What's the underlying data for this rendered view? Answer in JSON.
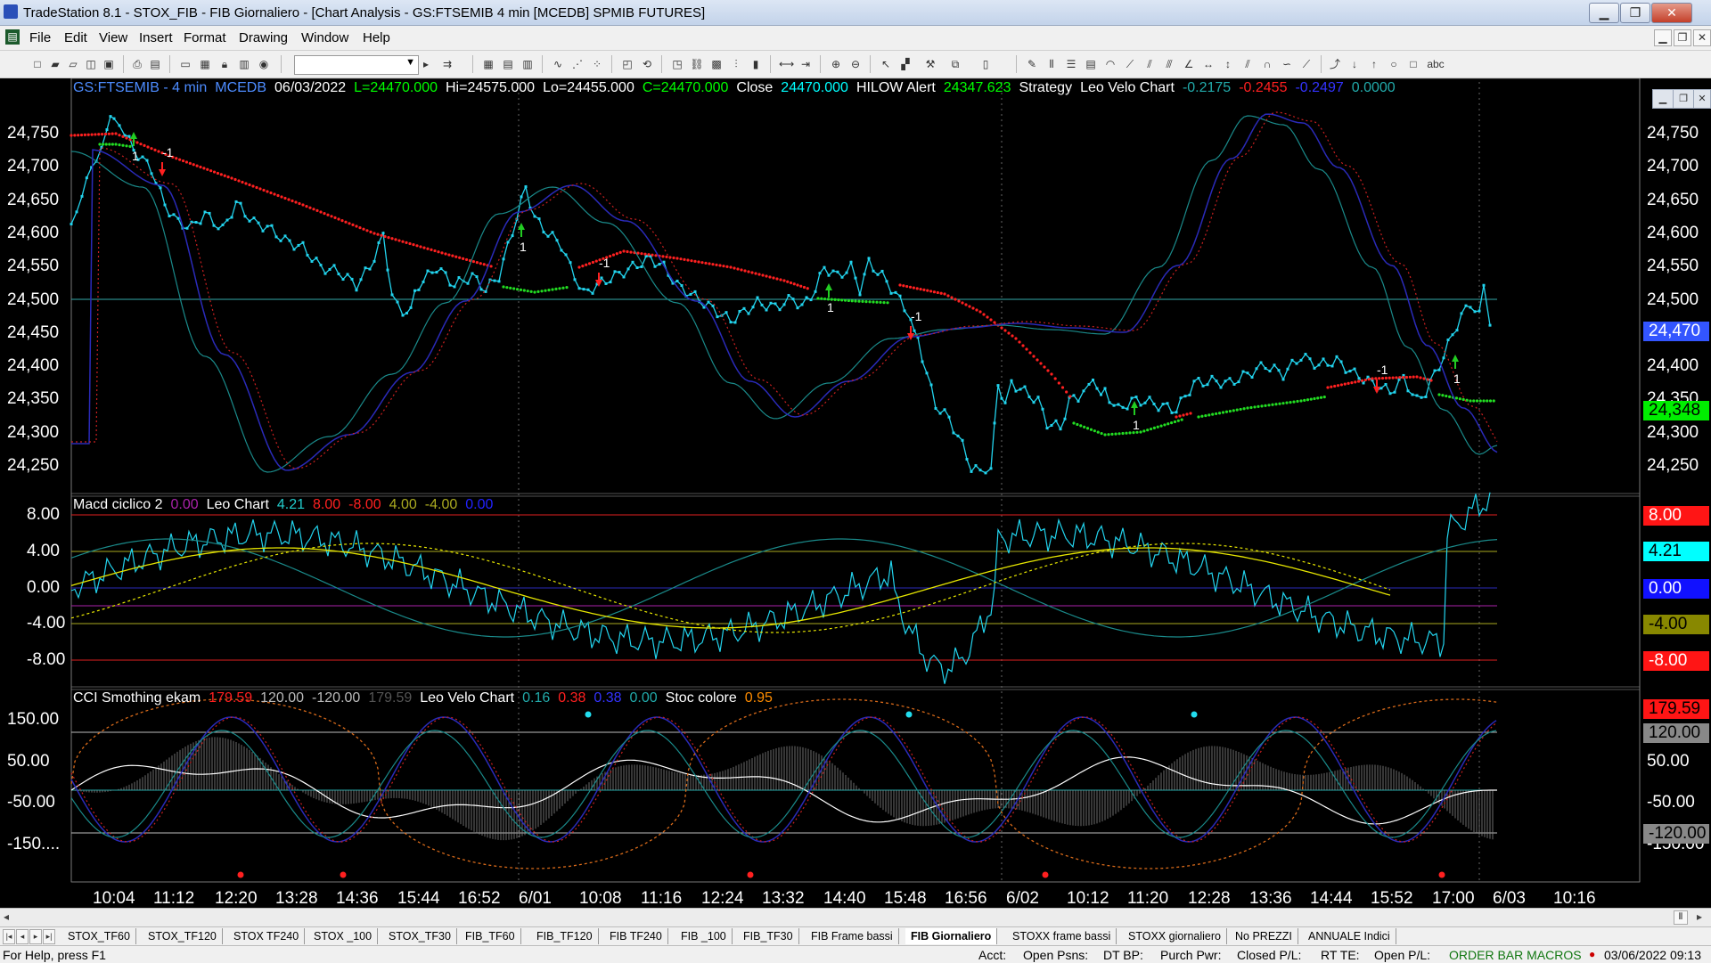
{
  "window": {
    "title": "TradeStation 8.1 - STOX_FIB - FIB Giornaliero - [Chart Analysis - GS:FTSEMIB  4 min  [MCEDB] SPMIB FUTURES]",
    "min_glyph": "▁",
    "max_glyph": "❐",
    "close_glyph": "✕"
  },
  "menu": {
    "items": [
      "File",
      "Edit",
      "View",
      "Insert",
      "Format",
      "Drawing",
      "Window",
      "Help"
    ],
    "mdi_min": "▁",
    "mdi_restore": "❐",
    "mdi_close": "✕"
  },
  "toolbar": {
    "combo_arrow": "▼",
    "icons": [
      "new-icon",
      "open-icon",
      "open-workspace-icon",
      "new-workspace-icon",
      "save-icon",
      "print-icon",
      "print-preview-icon",
      "window-icon",
      "window-tile-icon",
      "lock-icon",
      "macro-icon",
      "globe-icon",
      "play-icon",
      "go-icon",
      "chart-icon",
      "bar-icon",
      "candle-icon",
      "line-icon",
      "dots-icon",
      "scatter-icon",
      "insert-icon",
      "refresh-icon",
      "window-new-icon",
      "link-icon",
      "quote-icon",
      "stats-icon",
      "histo-icon",
      "gauge-icon",
      "speed-icon",
      "zoom-in-icon",
      "zoom-out-icon",
      "cursor-icon",
      "chart-type-icon",
      "tools-icon",
      "format-icon",
      "scroll-icon"
    ]
  },
  "chart": {
    "price_header": [
      {
        "t": "GS:FTSEMIB - 4 min",
        "c": "#4d8cff"
      },
      {
        "t": "MCEDB",
        "c": "#4d8cff"
      },
      {
        "t": "06/03/2022",
        "c": "#ffffff"
      },
      {
        "t": "L=24470.000",
        "c": "#00ff00"
      },
      {
        "t": "Hi=24575.000",
        "c": "#ffffff"
      },
      {
        "t": "Lo=24455.000",
        "c": "#ffffff"
      },
      {
        "t": "C=24470.000",
        "c": "#00ff00"
      },
      {
        "t": "Close",
        "c": "#ffffff"
      },
      {
        "t": "24470.000",
        "c": "#00ffff"
      },
      {
        "t": "HILOW Alert",
        "c": "#ffffff"
      },
      {
        "t": "24347.623",
        "c": "#00ff00"
      },
      {
        "t": "Strategy",
        "c": "#ffffff"
      },
      {
        "t": "Leo Velo Chart",
        "c": "#ffffff"
      },
      {
        "t": "-0.2175",
        "c": "#22aaaa"
      },
      {
        "t": "-0.2455",
        "c": "#ff2020"
      },
      {
        "t": "-0.2497",
        "c": "#3333ff"
      },
      {
        "t": "0.0000",
        "c": "#22aaaa"
      }
    ],
    "macd_header": [
      {
        "t": "Macd ciclico 2",
        "c": "#ffffff"
      },
      {
        "t": "0.00",
        "c": "#aa22aa"
      },
      {
        "t": "Leo Chart",
        "c": "#ffffff"
      },
      {
        "t": "4.21",
        "c": "#22cccc"
      },
      {
        "t": "8.00",
        "c": "#ff2020"
      },
      {
        "t": "-8.00",
        "c": "#ff2020"
      },
      {
        "t": "4.00",
        "c": "#aaaa20"
      },
      {
        "t": "-4.00",
        "c": "#aaaa20"
      },
      {
        "t": "0.00",
        "c": "#2222ff"
      }
    ],
    "cci_header": [
      {
        "t": "CCI Smothing ekam",
        "c": "#ffffff"
      },
      {
        "t": "179.59",
        "c": "#ff2020"
      },
      {
        "t": "120.00",
        "c": "#bbbbbb"
      },
      {
        "t": "-120.00",
        "c": "#bbbbbb"
      },
      {
        "t": "179.59",
        "c": "#555555"
      },
      {
        "t": "Leo Velo Chart",
        "c": "#ffffff"
      },
      {
        "t": "0.16",
        "c": "#22aaaa"
      },
      {
        "t": "0.38",
        "c": "#ff2020"
      },
      {
        "t": "0.38",
        "c": "#3333ff"
      },
      {
        "t": "0.00",
        "c": "#22aaaa"
      },
      {
        "t": "Stoc colore",
        "c": "#ffffff"
      },
      {
        "t": "0.95",
        "c": "#ff8c00"
      }
    ],
    "price_axis": [
      "24,750",
      "24,700",
      "24,650",
      "24,600",
      "24,550",
      "24,500",
      "24,450",
      "24,400",
      "24,350",
      "24,300",
      "24,250"
    ],
    "macd_axis": [
      "8.00",
      "4.00",
      "0.00",
      "-4.00",
      "-8.00"
    ],
    "cci_axis": [
      "150.00",
      "50.00",
      "-50.00",
      "-150...."
    ],
    "cci_axis_right": [
      "150.00",
      "50.00",
      "-50.00",
      "-150.00"
    ],
    "price_last": [
      {
        "t": "24,470",
        "bg": "#3355ff",
        "c": "#ffffff"
      },
      {
        "t": "24,348",
        "bg": "#00ee00",
        "c": "#000000"
      }
    ],
    "macd_last": [
      {
        "t": "8.00",
        "bg": "#ff1515",
        "c": "#ffffff"
      },
      {
        "t": "4.21",
        "bg": "#00ffff",
        "c": "#000000"
      },
      {
        "t": "0.00",
        "bg": "#1111ff",
        "c": "#ffffff"
      },
      {
        "t": "-4.00",
        "bg": "#888800",
        "c": "#000000"
      },
      {
        "t": "-8.00",
        "bg": "#ff1515",
        "c": "#ffffff"
      }
    ],
    "cci_last": [
      {
        "t": "179.59",
        "bg": "#ff1515",
        "c": "#000000"
      },
      {
        "t": "120.00",
        "bg": "#888888",
        "c": "#000000"
      },
      {
        "t": "-120.00",
        "bg": "#888888",
        "c": "#000000"
      }
    ],
    "time_axis": [
      "10:04",
      "11:12",
      "12:20",
      "13:28",
      "14:36",
      "15:44",
      "16:52",
      "6/01",
      "10:08",
      "11:16",
      "12:24",
      "13:32",
      "14:40",
      "15:48",
      "16:56",
      "6/02",
      "10:12",
      "11:20",
      "12:28",
      "13:36",
      "14:44",
      "15:52",
      "17:00",
      "6/03",
      "10:16"
    ],
    "strategy_labels": [
      "1",
      "-1",
      "1",
      "-1",
      "1",
      "-1",
      "1",
      "-1",
      "1"
    ],
    "colors": {
      "price": "#22d4ee",
      "stop_red": "#ff2020",
      "stop_green": "#22dd22",
      "blue": "#2a2ab8",
      "teal": "#1a8a8a",
      "red_dot": "#cc2020",
      "yellow": "#e6e600",
      "orange": "#d86a1a",
      "grid": "#cccccc"
    }
  },
  "tabs": [
    "STOX_TF60",
    "STOX_TF120",
    "STOX TF240",
    "STOX _100",
    "STOX_TF30",
    "FIB_TF60",
    "FIB_TF120",
    "FIB TF240",
    "FIB _100",
    "FIB_TF30",
    "FIB Frame bassi",
    "FIB Giornaliero",
    "STOXX frame bassi",
    "STOXX giornaliero",
    "No PREZZI",
    "ANNUALE Indici"
  ],
  "active_tab": "FIB Giornaliero",
  "status": {
    "help": "For Help, press F1",
    "acct": "Acct:",
    "open_psns": "Open Psns:",
    "dt_bp": "DT BP:",
    "purch_pwr": "Purch Pwr:",
    "closed_pl": "Closed P/L:",
    "rt_te": "RT TE:",
    "open_pl": "Open P/L:",
    "mode": "ORDER BAR MACROS",
    "datetime": "03/06/2022 09:13"
  }
}
